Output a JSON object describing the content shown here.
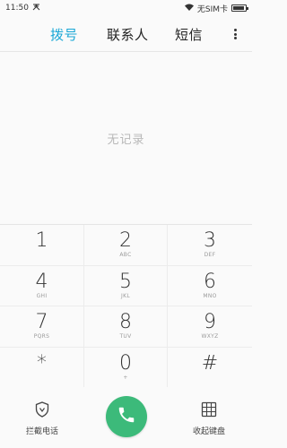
{
  "status_bar": {
    "time": "11:50",
    "sim_status": "无SIM卡",
    "icons": [
      "notification-icon",
      "wifi-icon",
      "battery-icon"
    ],
    "battery_level": 0.9
  },
  "tabs": [
    {
      "label": "拨号",
      "active": true
    },
    {
      "label": "联系人",
      "active": false
    },
    {
      "label": "短信",
      "active": false
    }
  ],
  "accent_color": "#19a7d6",
  "call_color": "#3cba7a",
  "empty_message": "无记录",
  "keypad": [
    {
      "digit": "1",
      "letters": ""
    },
    {
      "digit": "2",
      "letters": "ABC"
    },
    {
      "digit": "3",
      "letters": "DEF"
    },
    {
      "digit": "4",
      "letters": "GHI"
    },
    {
      "digit": "5",
      "letters": "JKL"
    },
    {
      "digit": "6",
      "letters": "MNO"
    },
    {
      "digit": "7",
      "letters": "PQRS"
    },
    {
      "digit": "8",
      "letters": "TUV"
    },
    {
      "digit": "9",
      "letters": "WXYZ"
    },
    {
      "digit": "*",
      "letters": ""
    },
    {
      "digit": "0",
      "letters": "+"
    },
    {
      "digit": "#",
      "letters": ""
    }
  ],
  "bottom_bar": {
    "left_label": "拦截电话",
    "left_icon": "shield-icon",
    "call_icon": "phone-icon",
    "right_label": "收起键盘",
    "right_icon": "keyboard-grid-icon"
  }
}
